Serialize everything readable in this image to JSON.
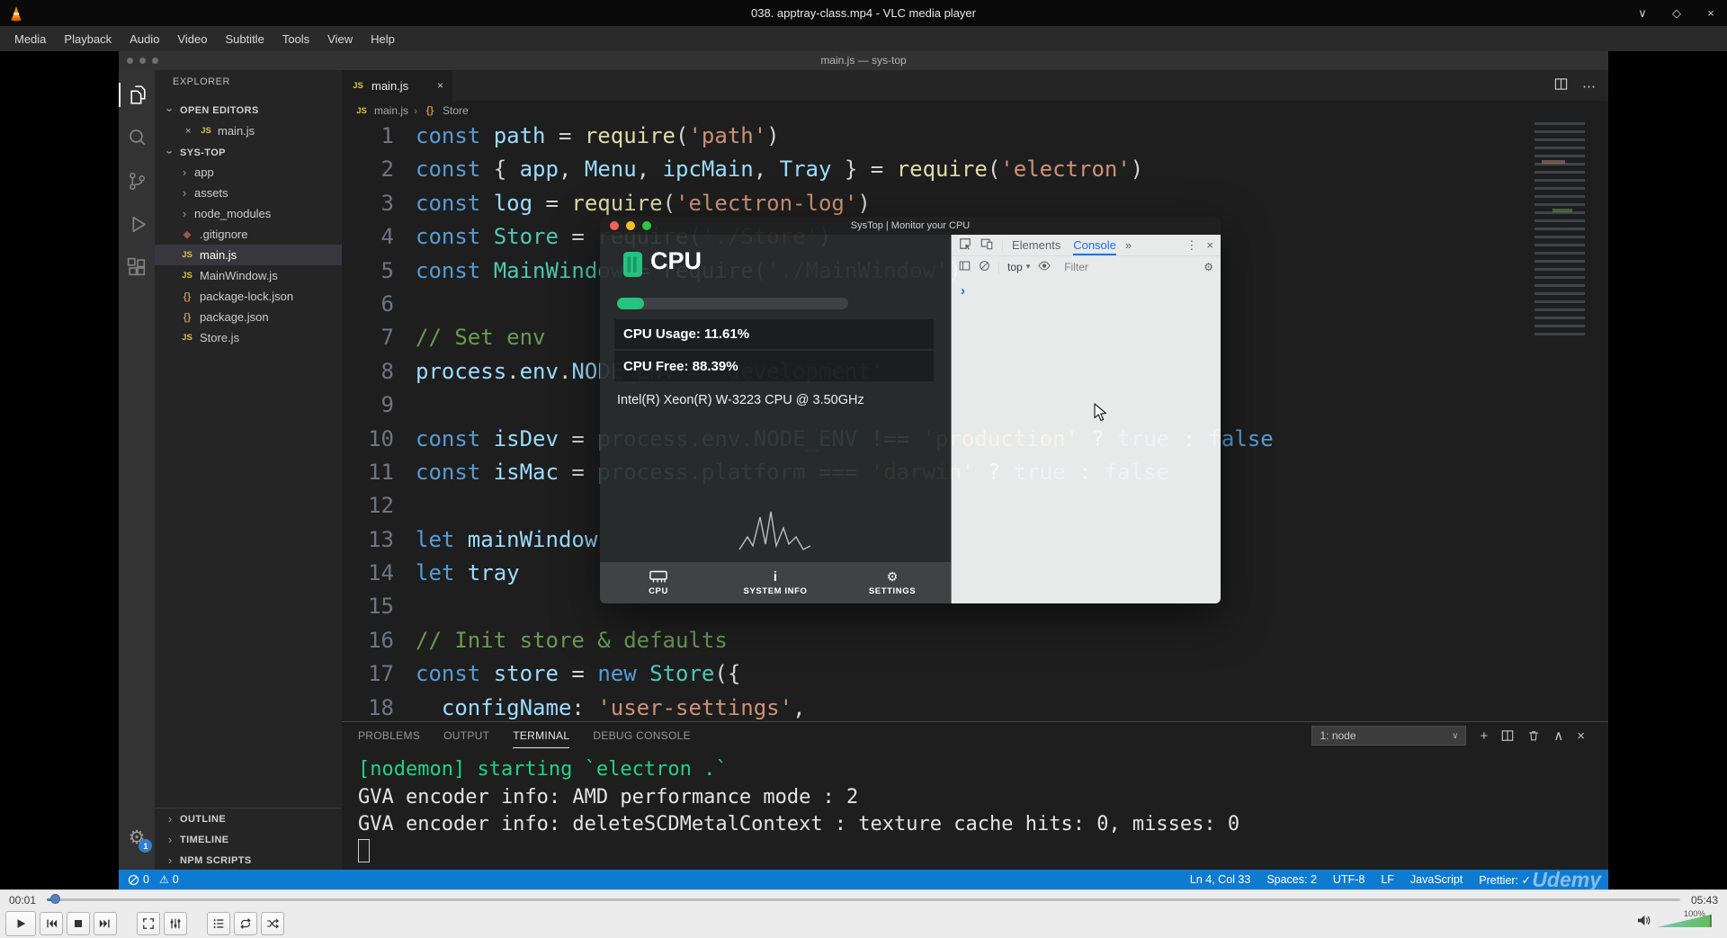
{
  "icons": {
    "close_x": "×",
    "minimize": "∨",
    "maximize": "◇",
    "chevron_right": "›",
    "chevron_down": "∨",
    "chevron_up": "∧",
    "caret_down": "▾",
    "more_h": "⋯",
    "more_v": "⋮",
    "double_chevron": "»",
    "plus": "+",
    "gear": "⚙",
    "info": "i",
    "prompt": "›",
    "warning": "⚠",
    "js_badge": "JS",
    "braces": "{}"
  },
  "vlc": {
    "titlebar": {
      "title": "038. apptray-class.mp4 - VLC media player"
    },
    "menu": [
      "Media",
      "Playback",
      "Audio",
      "Video",
      "Subtitle",
      "Tools",
      "View",
      "Help"
    ],
    "seek": {
      "current": "00:01",
      "total": "05:43",
      "volume": "100%"
    }
  },
  "video": {
    "vscode": {
      "title": "main.js — sys-top",
      "settings_badge": "1",
      "explorer": {
        "header": "EXPLORER",
        "open_editors": "OPEN EDITORS",
        "open_file": "main.js",
        "folder": "SYS-TOP",
        "files": [
          {
            "icon": "chevron",
            "label": "app"
          },
          {
            "icon": "chevron",
            "label": "assets"
          },
          {
            "icon": "chevron",
            "label": "node_modules"
          },
          {
            "icon": "git",
            "label": ".gitignore"
          },
          {
            "icon": "js",
            "label": "main.js",
            "selected": true
          },
          {
            "icon": "js",
            "label": "MainWindow.js"
          },
          {
            "icon": "braces",
            "label": "package-lock.json"
          },
          {
            "icon": "braces",
            "label": "package.json"
          },
          {
            "icon": "js",
            "label": "Store.js"
          }
        ],
        "sections": [
          "OUTLINE",
          "TIMELINE",
          "NPM SCRIPTS"
        ]
      },
      "tab": "main.js",
      "breadcrumb": [
        "main.js",
        "Store"
      ],
      "code": [
        {
          "n": 1,
          "t": [
            [
              "k",
              "const"
            ],
            [
              "v",
              " path "
            ],
            [
              "o",
              "= "
            ],
            [
              "f",
              "require"
            ],
            [
              "o",
              "("
            ],
            [
              "s",
              "'path'"
            ],
            [
              "o",
              ")"
            ]
          ]
        },
        {
          "n": 2,
          "t": [
            [
              "k",
              "const"
            ],
            [
              "o",
              " { "
            ],
            [
              "v",
              "app"
            ],
            [
              "o",
              ", "
            ],
            [
              "v",
              "Menu"
            ],
            [
              "o",
              ", "
            ],
            [
              "v",
              "ipcMain"
            ],
            [
              "o",
              ", "
            ],
            [
              "v",
              "Tray"
            ],
            [
              "o",
              " } = "
            ],
            [
              "f",
              "require"
            ],
            [
              "o",
              "("
            ],
            [
              "s",
              "'electron'"
            ],
            [
              "o",
              ")"
            ]
          ]
        },
        {
          "n": 3,
          "t": [
            [
              "k",
              "const"
            ],
            [
              "v",
              " log "
            ],
            [
              "o",
              "= "
            ],
            [
              "f",
              "require"
            ],
            [
              "o",
              "("
            ],
            [
              "s",
              "'electron-log'"
            ],
            [
              "o",
              ")"
            ]
          ]
        },
        {
          "n": 4,
          "t": [
            [
              "k",
              "const"
            ],
            [
              "c",
              " Store "
            ],
            [
              "o",
              "= "
            ],
            [
              "f",
              "require"
            ],
            [
              "o",
              "("
            ],
            [
              "s",
              "'./Store'"
            ],
            [
              "o",
              ")"
            ]
          ]
        },
        {
          "n": 5,
          "t": [
            [
              "k",
              "const"
            ],
            [
              "c",
              " MainWindow "
            ],
            [
              "o",
              "= "
            ],
            [
              "f",
              "require"
            ],
            [
              "o",
              "("
            ],
            [
              "s",
              "'./MainWindow'"
            ],
            [
              "o",
              ")"
            ]
          ]
        },
        {
          "n": 6,
          "t": []
        },
        {
          "n": 7,
          "t": [
            [
              "m",
              "// Set env"
            ]
          ]
        },
        {
          "n": 8,
          "t": [
            [
              "v",
              "process"
            ],
            [
              "o",
              "."
            ],
            [
              "v",
              "env"
            ],
            [
              "o",
              "."
            ],
            [
              "v",
              "NODE_ENV"
            ],
            [
              "o",
              " = "
            ],
            [
              "s",
              "'development'"
            ]
          ]
        },
        {
          "n": 9,
          "t": []
        },
        {
          "n": 10,
          "t": [
            [
              "k",
              "const"
            ],
            [
              "v",
              " isDev "
            ],
            [
              "o",
              "= "
            ],
            [
              "v",
              "process"
            ],
            [
              "o",
              "."
            ],
            [
              "v",
              "env"
            ],
            [
              "o",
              "."
            ],
            [
              "v",
              "NODE_ENV"
            ],
            [
              "o",
              " !== "
            ],
            [
              "s",
              "'production'"
            ],
            [
              "o",
              " ? "
            ],
            [
              "k",
              "true"
            ],
            [
              "o",
              " : "
            ],
            [
              "k",
              "false"
            ]
          ]
        },
        {
          "n": 11,
          "t": [
            [
              "k",
              "const"
            ],
            [
              "v",
              " isMac "
            ],
            [
              "o",
              "= "
            ],
            [
              "v",
              "process"
            ],
            [
              "o",
              "."
            ],
            [
              "v",
              "platform"
            ],
            [
              "o",
              " === "
            ],
            [
              "s",
              "'darwin'"
            ],
            [
              "o",
              " ? "
            ],
            [
              "k",
              "true"
            ],
            [
              "o",
              " : "
            ],
            [
              "k",
              "false"
            ]
          ]
        },
        {
          "n": 12,
          "t": []
        },
        {
          "n": 13,
          "t": [
            [
              "k",
              "let"
            ],
            [
              "v",
              " mainWindow"
            ]
          ]
        },
        {
          "n": 14,
          "t": [
            [
              "k",
              "let"
            ],
            [
              "v",
              " tray"
            ]
          ]
        },
        {
          "n": 15,
          "t": []
        },
        {
          "n": 16,
          "t": [
            [
              "m",
              "// Init store & defaults"
            ]
          ]
        },
        {
          "n": 17,
          "t": [
            [
              "k",
              "const"
            ],
            [
              "v",
              " store "
            ],
            [
              "o",
              "= "
            ],
            [
              "k",
              "new"
            ],
            [
              "c",
              " Store"
            ],
            [
              "o",
              "({"
            ]
          ]
        },
        {
          "n": 18,
          "t": [
            [
              "o",
              "  "
            ],
            [
              "v",
              "configName"
            ],
            [
              "o",
              ": "
            ],
            [
              "s",
              "'user-settings'"
            ],
            [
              "o",
              ","
            ]
          ]
        }
      ],
      "panel": {
        "tabs": [
          "PROBLEMS",
          "OUTPUT",
          "TERMINAL",
          "DEBUG CONSOLE"
        ],
        "active_tab": "TERMINAL",
        "shell_select": "1: node",
        "terminal": [
          {
            "c": "green",
            "text": "[nodemon] starting `electron .`"
          },
          {
            "c": "plain",
            "text": "GVA encoder info: AMD performance mode : 2"
          },
          {
            "c": "plain",
            "text": "GVA encoder info: deleteSCDMetalContext : texture cache hits: 0, misses: 0"
          }
        ]
      },
      "status": {
        "errors": "0",
        "warnings": "0",
        "right": [
          "Ln 4, Col 33",
          "Spaces: 2",
          "UTF-8",
          "LF",
          "JavaScript",
          "Prettier: ✓"
        ]
      },
      "watermark": "Udemy"
    },
    "systop": {
      "title": "SysTop | Monitor your CPU",
      "heading": "CPU",
      "progress_percent": 11.61,
      "rows": [
        "CPU Usage: 11.61%",
        "CPU Free: 88.39%"
      ],
      "cpu_model": "Intel(R) Xeon(R) W-3223 CPU @ 3.50GHz",
      "accent": "#26c281",
      "nav": [
        {
          "icon": "chip",
          "label": "CPU"
        },
        {
          "icon": "info",
          "label": "SYSTEM INFO"
        },
        {
          "icon": "gear",
          "label": "SETTINGS"
        }
      ]
    },
    "devtools": {
      "tabs": [
        "Elements",
        "Console"
      ],
      "active_tab": "Console",
      "context": "top",
      "filter_placeholder": "Filter"
    }
  }
}
